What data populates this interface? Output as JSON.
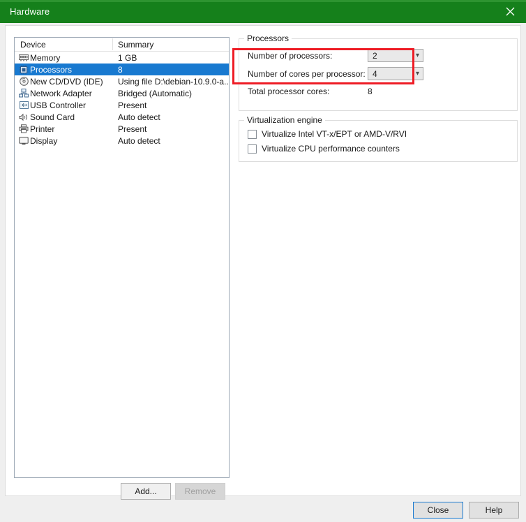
{
  "window": {
    "title": "Hardware",
    "close_icon": "close-icon",
    "accent_color": "#15801b"
  },
  "device_list": {
    "columns": [
      "Device",
      "Summary"
    ],
    "rows": [
      {
        "icon": "memory-stick-icon",
        "device": "Memory",
        "summary": "1 GB",
        "selected": false
      },
      {
        "icon": "cpu-chip-icon",
        "device": "Processors",
        "summary": "8",
        "selected": true
      },
      {
        "icon": "optical-disc-icon",
        "device": "New CD/DVD (IDE)",
        "summary": "Using file D:\\debian-10.9.0-a...",
        "selected": false
      },
      {
        "icon": "network-adapter-icon",
        "device": "Network Adapter",
        "summary": "Bridged (Automatic)",
        "selected": false
      },
      {
        "icon": "usb-icon",
        "device": "USB Controller",
        "summary": "Present",
        "selected": false
      },
      {
        "icon": "speaker-icon",
        "device": "Sound Card",
        "summary": "Auto detect",
        "selected": false
      },
      {
        "icon": "printer-icon",
        "device": "Printer",
        "summary": "Present",
        "selected": false
      },
      {
        "icon": "display-monitor-icon",
        "device": "Display",
        "summary": "Auto detect",
        "selected": false
      }
    ],
    "add_label": "Add...",
    "remove_label": "Remove"
  },
  "processors": {
    "group_label": "Processors",
    "num_processors_label": "Number of processors:",
    "num_processors_value": "2",
    "cores_per_processor_label": "Number of cores per processor:",
    "cores_per_processor_value": "4",
    "total_cores_label": "Total processor cores:",
    "total_cores_value": "8",
    "highlight_color": "#ee1c25"
  },
  "virtualization": {
    "group_label": "Virtualization engine",
    "options": [
      {
        "label": "Virtualize Intel VT-x/EPT or AMD-V/RVI",
        "checked": false
      },
      {
        "label": "Virtualize CPU performance counters",
        "checked": false
      }
    ]
  },
  "footer": {
    "close_label": "Close",
    "help_label": "Help"
  }
}
